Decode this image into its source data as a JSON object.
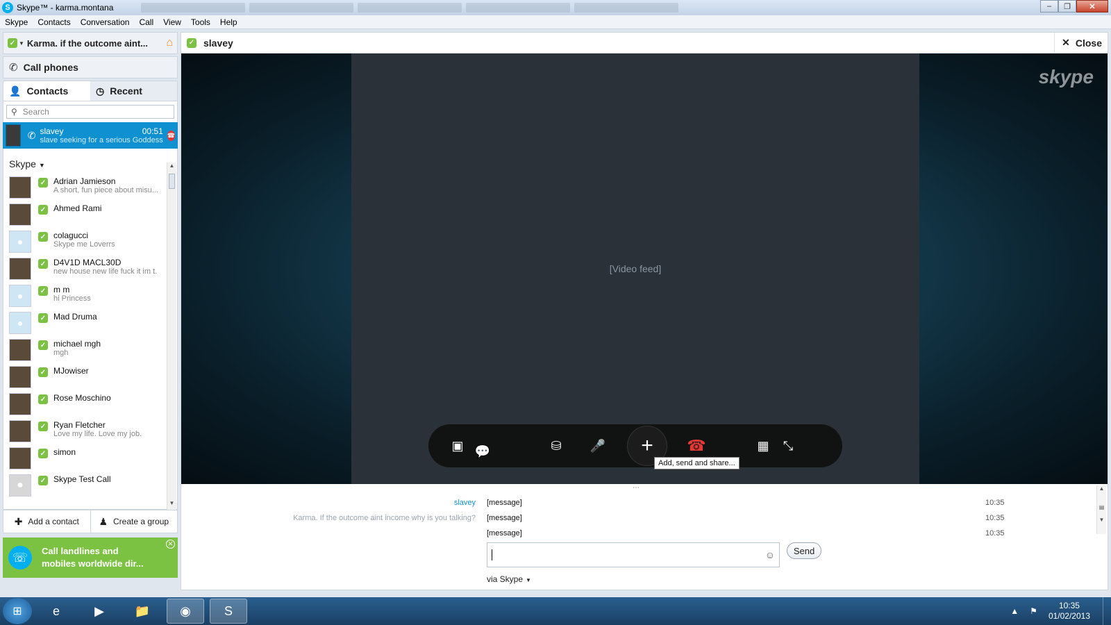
{
  "window": {
    "title": "Skype™ - karma.montana"
  },
  "menu": [
    "Skype",
    "Contacts",
    "Conversation",
    "Call",
    "View",
    "Tools",
    "Help"
  ],
  "profile": {
    "mood": "Karma. if the outcome aint..."
  },
  "call_phones_label": "Call phones",
  "tabs": {
    "contacts": "Contacts",
    "recent": "Recent"
  },
  "search": {
    "placeholder": "Search"
  },
  "active_call": {
    "name": "slavey",
    "duration": "00:51",
    "mood": "slave seeking for a serious Goddess"
  },
  "group_label": "Skype",
  "contacts": [
    {
      "name": "Adrian Jamieson",
      "mood": "A short, fun piece about misu..."
    },
    {
      "name": "Ahmed Rami",
      "mood": ""
    },
    {
      "name": "colagucci",
      "mood": "Skype me Loverrs"
    },
    {
      "name": "D4V1D MACL30D",
      "mood": "new house new life fuck it im t..."
    },
    {
      "name": "m m",
      "mood": "hi Princess"
    },
    {
      "name": "Mad Druma",
      "mood": ""
    },
    {
      "name": "michael mgh",
      "mood": "mgh"
    },
    {
      "name": "MJowiser",
      "mood": ""
    },
    {
      "name": "Rose Moschino",
      "mood": ""
    },
    {
      "name": "Ryan Fletcher",
      "mood": "Love my life. Love my job."
    },
    {
      "name": "simon",
      "mood": ""
    },
    {
      "name": "Skype Test Call",
      "mood": ""
    }
  ],
  "left_actions": {
    "add_contact": "Add a contact",
    "create_group": "Create a group"
  },
  "promo": {
    "line1": "Call landlines and",
    "line2": "mobiles worldwide dir..."
  },
  "conversation": {
    "contact_name": "slavey",
    "close_label": "Close",
    "video_placeholder": "[Video feed]",
    "watermark": "skype",
    "tooltip": "Add, send and share...",
    "messages": [
      {
        "sender": "slavey",
        "text": "[message]",
        "time": "10:35"
      },
      {
        "sender": "Karma. If the outcome aint income why is you talking?",
        "text": "[message]",
        "time": "10:35"
      },
      {
        "sender": "",
        "text": "[message]",
        "time": "10:35"
      }
    ],
    "send_label": "Send",
    "via_label": "via Skype"
  },
  "taskbar": {
    "time": "10:35",
    "date": "01/02/2013"
  },
  "colors": {
    "accent": "#0f91d1",
    "online": "#7cc242",
    "promo": "#7cc242",
    "hangup": "#e53935"
  }
}
